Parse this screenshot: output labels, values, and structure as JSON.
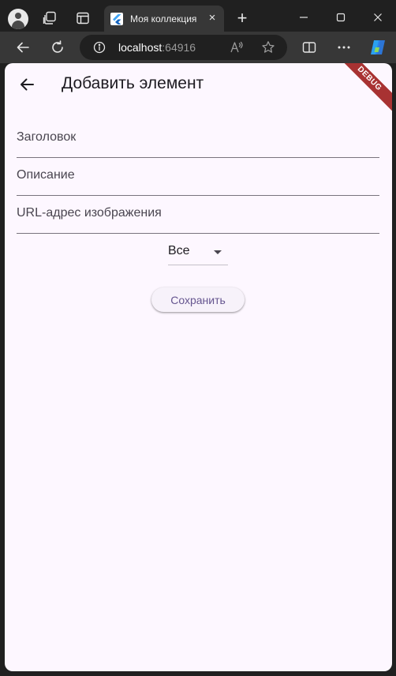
{
  "browser": {
    "tab_title": "Моя коллекция",
    "tab_close_glyph": "×",
    "new_tab_glyph": "+",
    "url_host": "localhost",
    "url_port": ":64916"
  },
  "app": {
    "title": "Добавить элемент",
    "debug_banner": "DEBUG",
    "fields": {
      "title_placeholder": "Заголовок",
      "description_placeholder": "Описание",
      "image_url_placeholder": "URL-адрес изображения"
    },
    "category_dropdown": {
      "selected": "Все"
    },
    "save_label": "Сохранить"
  },
  "colors": {
    "page_background": "#fdf7ff",
    "accent": "#65558f",
    "debug_banner": "#a83232",
    "chrome_dark": "#202020",
    "chrome_toolbar": "#373737"
  }
}
